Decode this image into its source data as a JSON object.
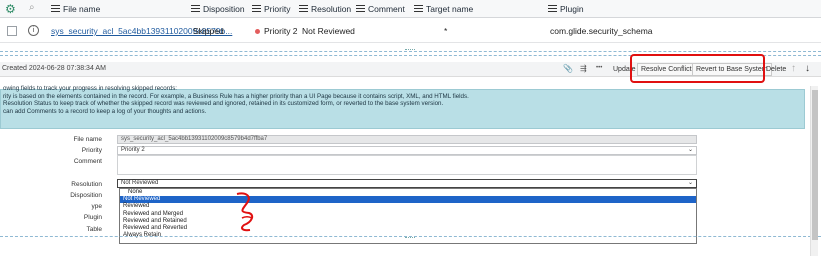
{
  "list": {
    "columns": [
      "File name",
      "Disposition",
      "Priority",
      "Resolution",
      "Comment",
      "Target name",
      "Plugin"
    ],
    "row": {
      "file_name": "sys_security_acl_5ac4bb1393110​2009c8579b...",
      "disposition": "Skipped",
      "priority": "Priority 2",
      "resolution": "Not Reviewed",
      "comment": "",
      "target_name": "*",
      "plugin": "com.glide.security_schema"
    }
  },
  "toolbar": {
    "created": "Created 2024-06-28 07:38:34 AM",
    "icons": [
      "paperclip-icon",
      "sliders-icon",
      "more-icon"
    ],
    "more_label": "•••",
    "update_label": "Update",
    "resolve_label": "Resolve Conflicts",
    "revert_label": "Revert to Base System",
    "delete_label": "Delete",
    "up_arrow": "↑",
    "down_arrow": "↓"
  },
  "banner": {
    "lines": [
      "owing fields to track your progress in resolving skipped records:",
      "rity is based on the elements contained in the record. For example, a Business Rule has a higher priority than a UI Page because it contains script, XML, and HTML fields.",
      "Resolution Status to keep track of whether the skipped record was reviewed and ignored, retained in its customized form, or reverted to the base system version.",
      "can add Comments to a record to keep a log of your thoughts and actions."
    ]
  },
  "form": {
    "file_name_label": "File name",
    "file_name_value": "sys_security_acl_5ac4bb13931102009c8579b4d7ffba7",
    "priority_label": "Priority",
    "priority_value": "Priority 2",
    "comment_label": "Comment",
    "resolution_label": "Resolution",
    "resolution_value": "Not Reviewed",
    "disposition_label": "Disposition",
    "type_label": "ype",
    "plugin_label": "Plugin",
    "table_label": "Table"
  },
  "dropdown_options": [
    {
      "label": "None",
      "selected": false
    },
    {
      "label": "Not Reviewed",
      "selected": true
    },
    {
      "label": "Reviewed",
      "selected": false
    },
    {
      "label": "Reviewed and Merged",
      "selected": false
    },
    {
      "label": "Reviewed and Retained",
      "selected": false
    },
    {
      "label": "Reviewed and Reverted",
      "selected": false
    },
    {
      "label": "Always Retain",
      "selected": false
    }
  ],
  "colors": {
    "accent_green": "#2c8a64",
    "banner_bg": "#b9dfe6",
    "selected_option": "#1e64c8",
    "annotation_red": "#e01010",
    "priority_dot": "#e35d5d"
  }
}
